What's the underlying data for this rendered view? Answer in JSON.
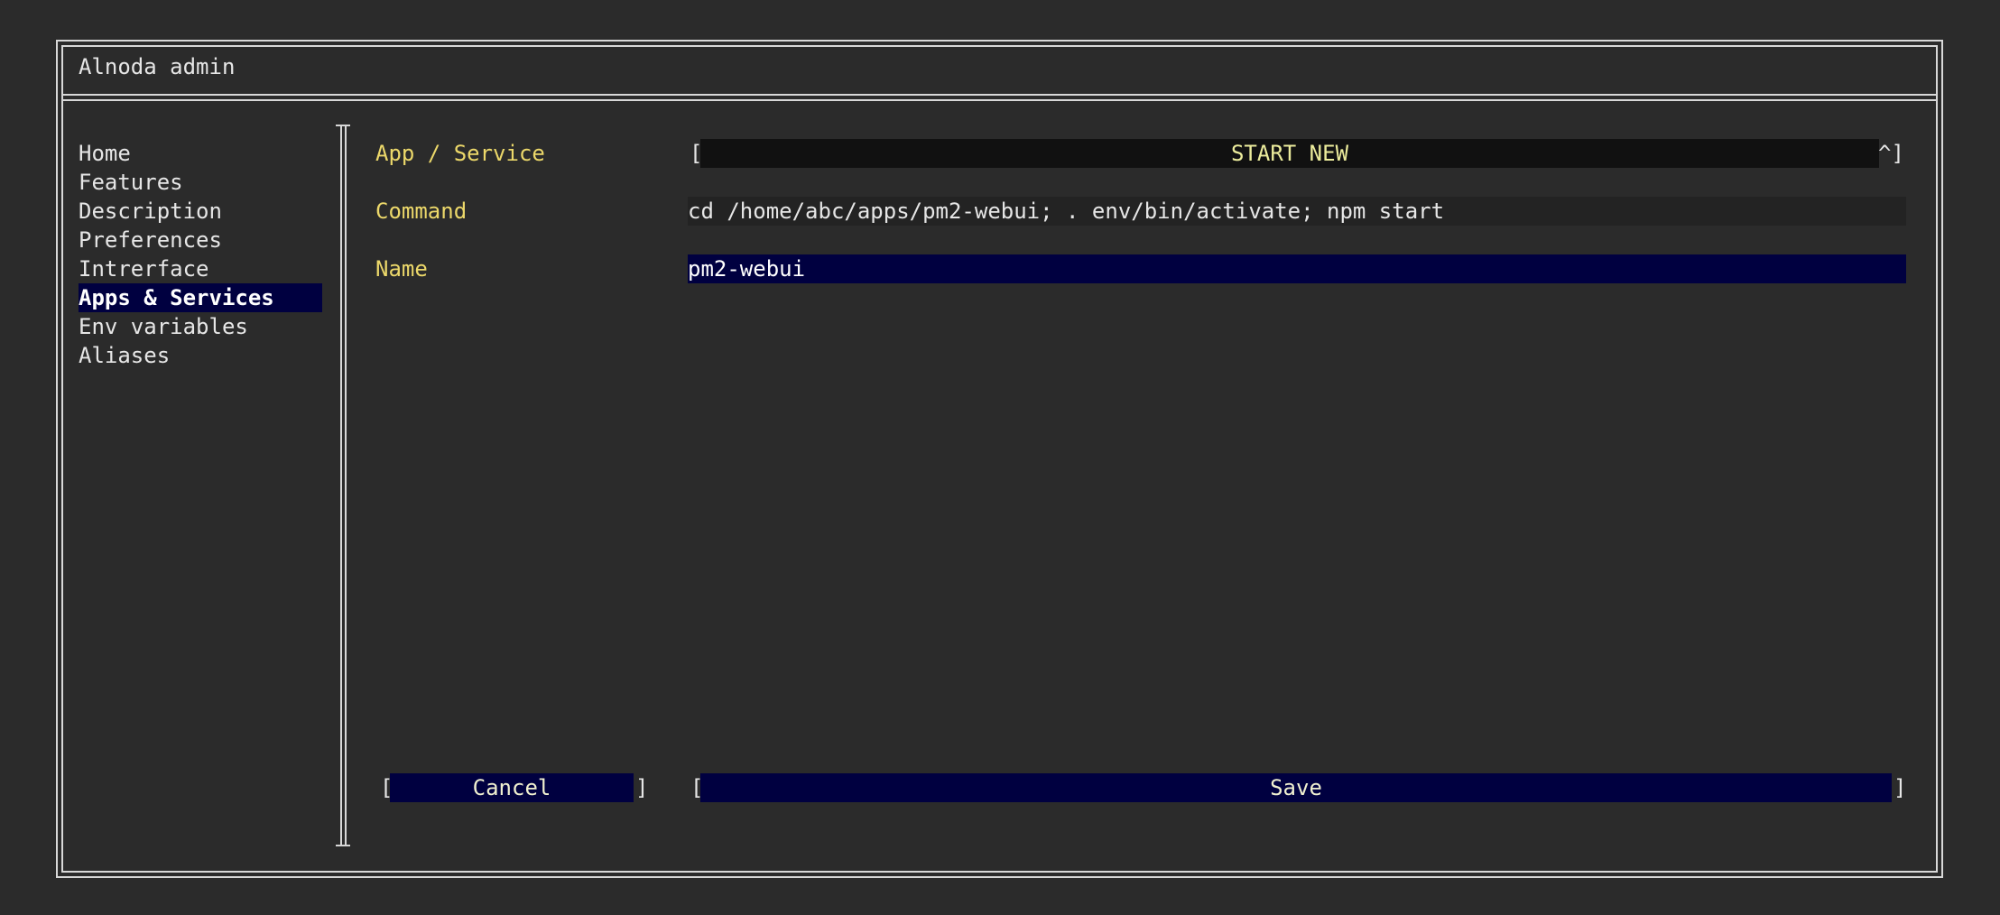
{
  "window": {
    "title": "Alnoda admin"
  },
  "sidebar": {
    "items": [
      {
        "label": "Home",
        "active": false
      },
      {
        "label": "Features",
        "active": false
      },
      {
        "label": "Description",
        "active": false
      },
      {
        "label": "Preferences",
        "active": false
      },
      {
        "label": "Intrerface",
        "active": false
      },
      {
        "label": "Apps & Services",
        "active": true
      },
      {
        "label": "Env variables",
        "active": false
      },
      {
        "label": "Aliases",
        "active": false
      }
    ]
  },
  "form": {
    "app_service": {
      "label": "App / Service",
      "value": "START NEW",
      "open_left": "[",
      "open_right": "^]"
    },
    "command": {
      "label": "Command",
      "value": "cd /home/abc/apps/pm2-webui; . env/bin/activate; npm start"
    },
    "name": {
      "label": "Name",
      "value": "pm2-webui"
    }
  },
  "buttons": {
    "cancel": {
      "label": "Cancel",
      "left": "[",
      "right": "]"
    },
    "save": {
      "label": "Save",
      "left": "[",
      "right": "]"
    }
  },
  "colors": {
    "background": "#2b2b2b",
    "label": "#ecd86a",
    "highlight": "#000040",
    "dropdown_bg": "#111111",
    "field_bg": "#222222",
    "border": "#d8d8d8"
  }
}
